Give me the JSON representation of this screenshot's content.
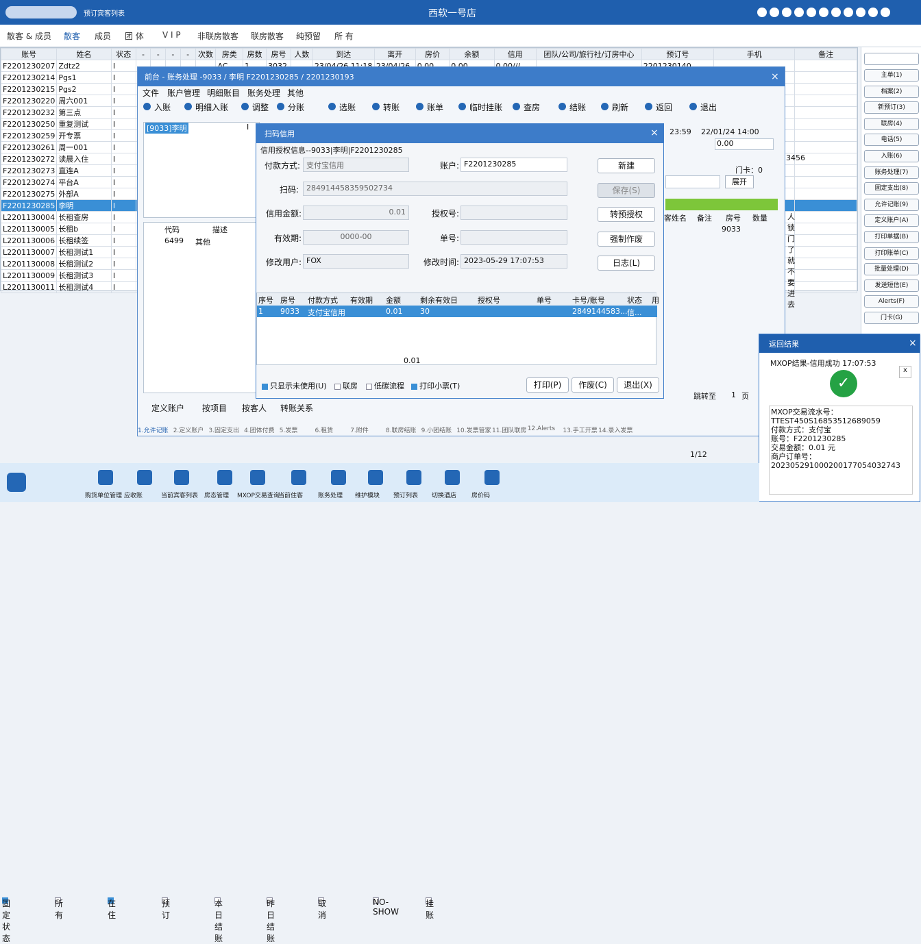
{
  "topbar": {
    "search_label": "预订宾客列表",
    "title": "西软一号店"
  },
  "menu": [
    "散客 & 成员",
    "散客",
    "成员",
    "团 体",
    "V I P",
    "非联房散客",
    "联房散客",
    "纯预留",
    "所 有"
  ],
  "grid": {
    "headers": [
      "账号",
      "姓名",
      "状态",
      "-",
      "-",
      "-",
      "-",
      "次数",
      "房类",
      "房数",
      "房号",
      "人数",
      "到达",
      "离开",
      "房价",
      "余额",
      "信用",
      "团队/公司/旅行社/订房中心",
      "预订号",
      "手机",
      "备注"
    ],
    "rows": [
      [
        "F2201230207",
        "Zdtz2",
        "I",
        "AC",
        "1",
        "3032",
        "23/04/26 11:18",
        "23/04/26",
        "0.00",
        "0.00",
        "0.00///",
        "2201230140"
      ],
      [
        "F2201230214",
        "Pgs1",
        "I"
      ],
      [
        "F2201230215",
        "Pgs2",
        "I"
      ],
      [
        "F2201230220",
        "周六001",
        "I"
      ],
      [
        "F2201230232",
        "第三点",
        "I"
      ],
      [
        "F2201230250",
        "重复测试",
        "I"
      ],
      [
        "F2201230259",
        "开专票",
        "I"
      ],
      [
        "F2201230261",
        "周一001",
        "I"
      ],
      [
        "F2201230272",
        "读晨入住",
        "I"
      ],
      [
        "F2201230273",
        "直连A",
        "I"
      ],
      [
        "F2201230274",
        "平台A",
        "I"
      ],
      [
        "F2201230275",
        "外部A",
        "I"
      ],
      [
        "F2201230285",
        "李明",
        "I"
      ],
      [
        "L2201130004",
        "长租查房",
        "I"
      ],
      [
        "L2201130005",
        "长租b",
        "I"
      ],
      [
        "L2201130006",
        "长租续签",
        "I"
      ],
      [
        "L2201130007",
        "长租测试1",
        "I"
      ],
      [
        "L2201130008",
        "长租测试2",
        "I"
      ],
      [
        "L2201130009",
        "长租测试3",
        "I"
      ],
      [
        "L2201130011",
        "长租测试4",
        "I"
      ]
    ]
  },
  "right_buttons": [
    "主单(1)",
    "档案(2)",
    "新预订(3)",
    "联房(4)",
    "电话(5)",
    "入账(6)",
    "账务处理(7)",
    "固定支出(8)",
    "允许记账(9)",
    "定义账户(A)",
    "打印单据(B)",
    "打印账单(C)",
    "批量处理(D)",
    "发送短信(E)",
    "Alerts(F)",
    "门卡(G)"
  ],
  "window": {
    "title": "前台 - 账务处理 -9033 / 李明 F2201230285 / 2201230193",
    "menu": [
      "文件",
      "账户管理",
      "明细账目",
      "账务处理",
      "其他"
    ],
    "toolbar": [
      "入账",
      "明细入账",
      "调整",
      "分账",
      "选账",
      "转账",
      "账单",
      "临时挂账",
      "查房",
      "结账",
      "刷新",
      "返回",
      "退出"
    ],
    "guest": "[9033]李明",
    "guest_status": "I",
    "time1": "23:59",
    "time2": "22/01/24 14:00",
    "amount": "0.00",
    "card": "门卡：0",
    "expand": "展开",
    "room_col": "房号",
    "room_val": "9033",
    "qty": "数量",
    "name_col": "客姓名",
    "note_col": "备注",
    "note_text": "人锁门了就不要进去",
    "code_hdr": [
      "代码",
      "描述"
    ],
    "code_row": [
      "6499",
      "其他"
    ],
    "acct_3456": "3456",
    "radios": [
      "定义账户",
      "按项目",
      "按客人",
      "转账关系"
    ],
    "page": "页",
    "goto": "跳转至",
    "page_num": "1",
    "tabs": [
      "1.允许记账",
      "2.定义账户",
      "3.固定支出",
      "4.团体付费",
      "5.发票",
      "6.租赁",
      "7.附件",
      "8.联房结账",
      "9.小团结账",
      "10.发票管家",
      "11.团队联房",
      "12.Alerts",
      "13.手工开票",
      "14.录入发票"
    ]
  },
  "dialog": {
    "title": "扫码信用",
    "header": "信用授权信息--9033|李明|F2201230285",
    "pay_label": "付款方式:",
    "pay_value": "支付宝信用",
    "account_label": "账户:",
    "account_value": "F2201230285",
    "scan_label": "扫码:",
    "scan_value": "284914458359502734",
    "amount_label": "信用金额:",
    "amount_value": "0.01",
    "auth_label": "授权号:",
    "expire_label": "有效期:",
    "expire_value": "0000-00",
    "bill_label": "单号:",
    "user_label": "修改用户:",
    "user_value": "FOX",
    "time_label": "修改时间:",
    "time_value": "2023-05-29 17:07:53",
    "buttons": [
      "新建",
      "保存(S)",
      "转预授权",
      "强制作废",
      "日志(L)"
    ],
    "table_headers": [
      "序号",
      "房号",
      "付款方式",
      "有效期",
      "金额",
      "剩余有效日",
      "授权号",
      "单号",
      "卡号/账号",
      "状态",
      "用"
    ],
    "row": [
      "1",
      "9033",
      "支付宝信用",
      "",
      "0.01",
      "30",
      "",
      "",
      "2849144583...",
      "信..."
    ],
    "total": "0.01",
    "check_labels": [
      "只显示未使用(U)",
      "联房",
      "低碳流程",
      "打印小票(T)"
    ],
    "bottom_buttons": [
      "打印(P)",
      "作废(C)",
      "退出(X)"
    ]
  },
  "result": {
    "title": "返回结果",
    "line1": "MXOP结果-信用成功  17:07:53",
    "close": "x",
    "details": [
      "MXOP交易流水号：",
      "TTEST450S16853512689059",
      "付款方式：支付宝",
      "账号：F2201230285",
      "交易金额：0.01 元",
      "商户订单号：",
      "202305291000200177054032743"
    ]
  },
  "filters": [
    "固定状态",
    "所有",
    "在住",
    "预订",
    "本日结账",
    "昨日结账",
    "取消",
    "NO-SHOW",
    "挂账"
  ],
  "page_info": "1/12",
  "bottom": [
    "购货单位管理",
    "应收账",
    "当前宾客列表",
    "房态管理",
    "MXOP交易查询",
    "当前住客",
    "账务处理",
    "维护模块",
    "预订列表",
    "切换酒店",
    "房价码"
  ]
}
